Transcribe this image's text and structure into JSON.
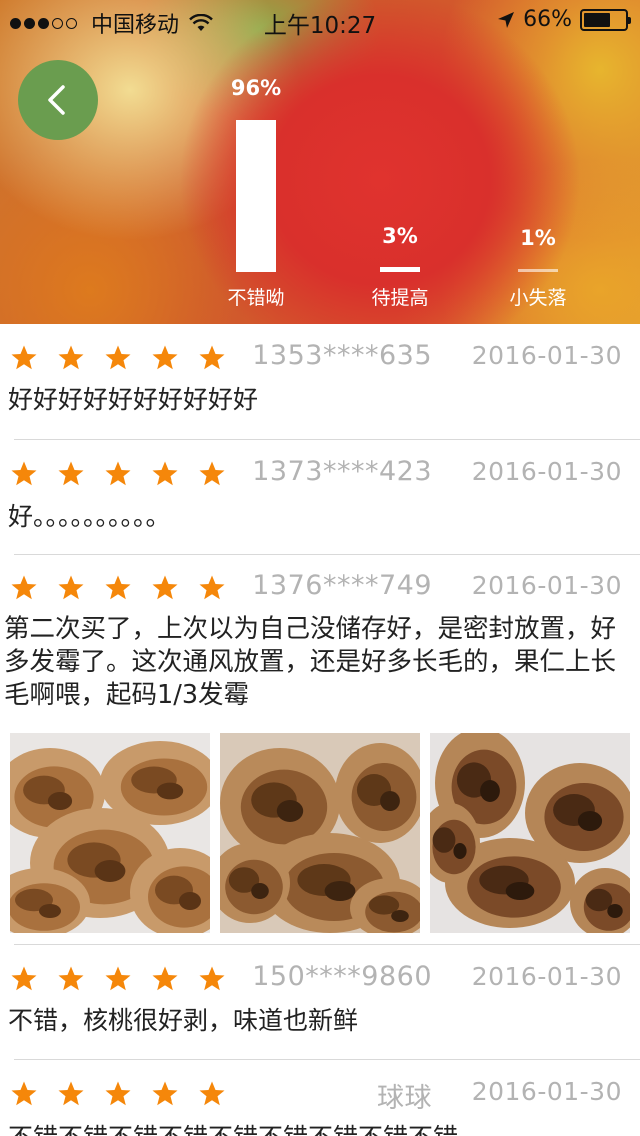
{
  "status_bar": {
    "carrier": "中国移动",
    "time": "上午10:27",
    "battery": "66%",
    "battery_level": 0.66
  },
  "rating_summary": [
    {
      "percent": "96%",
      "label": "不错呦",
      "value": 0.96
    },
    {
      "percent": "3%",
      "label": "待提高",
      "value": 0.03
    },
    {
      "percent": "1%",
      "label": "小失落",
      "value": 0.01
    }
  ],
  "colors": {
    "star": "#f5870a",
    "back_button": "#6a9d4f",
    "meta_text": "#b3b3b3"
  },
  "reviews": [
    {
      "stars": 5,
      "user": "1353****635",
      "date": "2016-01-30",
      "content": "好好好好好好好好好好"
    },
    {
      "stars": 5,
      "user": "1373****423",
      "date": "2016-01-30",
      "content": "好。。。。。。。。。。"
    },
    {
      "stars": 5,
      "user": "1376****749",
      "date": "2016-01-30",
      "content": "第二次买了，上次以为自己没储存好，是密封放置，好多发霉了。这次通风放置，还是好多长毛的，果仁上长毛啊喂，起码1/3发霉",
      "photos": [
        "walnut-photo-1",
        "walnut-photo-2",
        "walnut-photo-3"
      ]
    },
    {
      "stars": 5,
      "user": "150****9860",
      "date": "2016-01-30",
      "content": "不错，核桃很好剥，味道也新鲜"
    },
    {
      "stars": 5,
      "user": "球球",
      "date": "2016-01-30",
      "content": "不错不错不错不错不错不错不错不错不错"
    }
  ]
}
